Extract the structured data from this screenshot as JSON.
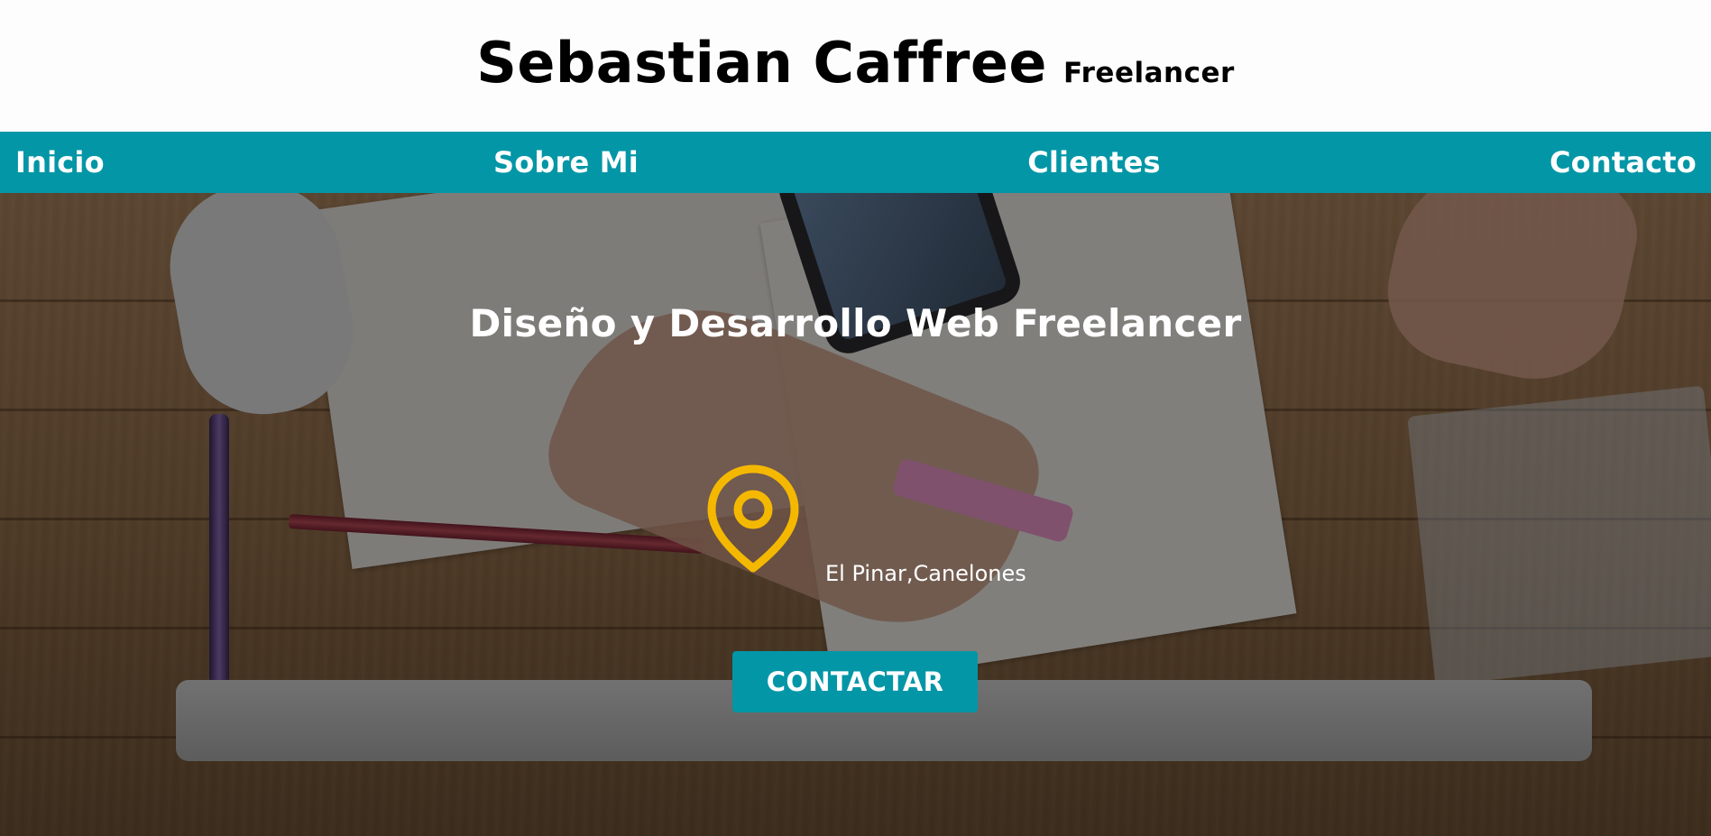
{
  "header": {
    "name": "Sebastian Caffree",
    "subtitle": "Freelancer"
  },
  "nav": {
    "items": [
      "Inicio",
      "Sobre Mi",
      "Clientes",
      "Contacto"
    ]
  },
  "hero": {
    "title": "Diseño y Desarrollo Web Freelancer",
    "location_icon": "map-pin-icon",
    "location": "El Pinar,Canelones",
    "cta_label": "CONTACTAR"
  },
  "colors": {
    "accent": "#0396a6",
    "pin": "#f5b800",
    "text_dark": "#000000",
    "text_light": "#ffffff"
  }
}
